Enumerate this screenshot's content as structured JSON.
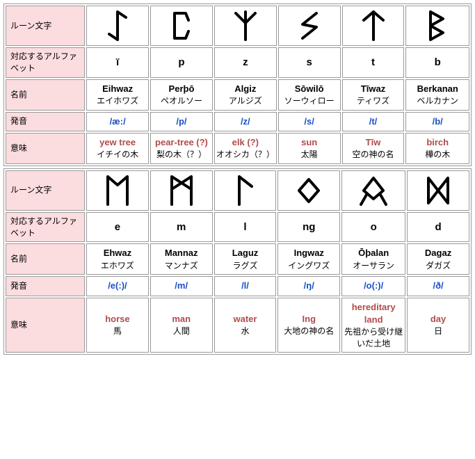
{
  "headers": {
    "rune": "ルーン文字",
    "alphabet": "対応するアルファベット",
    "name": "名前",
    "pronunciation": "発音",
    "meaning": "意味"
  },
  "tables": [
    {
      "runes": [
        {
          "svg": "eihwaz",
          "alpha": "ï",
          "name_en": "Eihwaz",
          "name_jp": "エイホワズ",
          "pron": "/æ:/",
          "mean_en": "yew tree",
          "mean_jp": "イチイの木"
        },
        {
          "svg": "pertho",
          "alpha": "p",
          "name_en": "Perþō",
          "name_jp": "ペオルソー",
          "pron": "/p/",
          "mean_en": "pear-tree (?)",
          "mean_jp": "梨の木（？）"
        },
        {
          "svg": "algiz",
          "alpha": "z",
          "name_en": "Algiz",
          "name_jp": "アルジズ",
          "pron": "/z/",
          "mean_en": "elk (?)",
          "mean_jp": "オオシカ（？）"
        },
        {
          "svg": "sowilo",
          "alpha": "s",
          "name_en": "Sōwilō",
          "name_jp": "ソーウィロー",
          "pron": "/s/",
          "mean_en": "sun",
          "mean_jp": "太陽"
        },
        {
          "svg": "tiwaz",
          "alpha": "t",
          "name_en": "Tīwaz",
          "name_jp": "ティワズ",
          "pron": "/t/",
          "mean_en": "Tīw",
          "mean_jp": "空の神の名"
        },
        {
          "svg": "berkanan",
          "alpha": "b",
          "name_en": "Berkanan",
          "name_jp": "ベルカナン",
          "pron": "/b/",
          "mean_en": "birch",
          "mean_jp": "樺の木"
        }
      ]
    },
    {
      "runes": [
        {
          "svg": "ehwaz",
          "alpha": "e",
          "name_en": "Ehwaz",
          "name_jp": "エホワズ",
          "pron": "/e(:)/",
          "mean_en": "horse",
          "mean_jp": "馬"
        },
        {
          "svg": "mannaz",
          "alpha": "m",
          "name_en": "Mannaz",
          "name_jp": "マンナズ",
          "pron": "/m/",
          "mean_en": "man",
          "mean_jp": "人間"
        },
        {
          "svg": "laguz",
          "alpha": "l",
          "name_en": "Laguz",
          "name_jp": "ラグズ",
          "pron": "/l/",
          "mean_en": "water",
          "mean_jp": "水"
        },
        {
          "svg": "ingwaz",
          "alpha": "ng",
          "name_en": "Ingwaz",
          "name_jp": "イングワズ",
          "pron": "/ŋ/",
          "mean_en": "Ing",
          "mean_jp": "大地の神の名"
        },
        {
          "svg": "othalan",
          "alpha": "o",
          "name_en": "Ōþalan",
          "name_jp": "オーサラン",
          "pron": "/o(:)/",
          "mean_en": "hereditary land",
          "mean_jp": "先祖から受け継いだ土地"
        },
        {
          "svg": "dagaz",
          "alpha": "d",
          "name_en": "Dagaz",
          "name_jp": "ダガズ",
          "pron": "/ð/",
          "mean_en": "day",
          "mean_jp": "日"
        }
      ]
    }
  ]
}
